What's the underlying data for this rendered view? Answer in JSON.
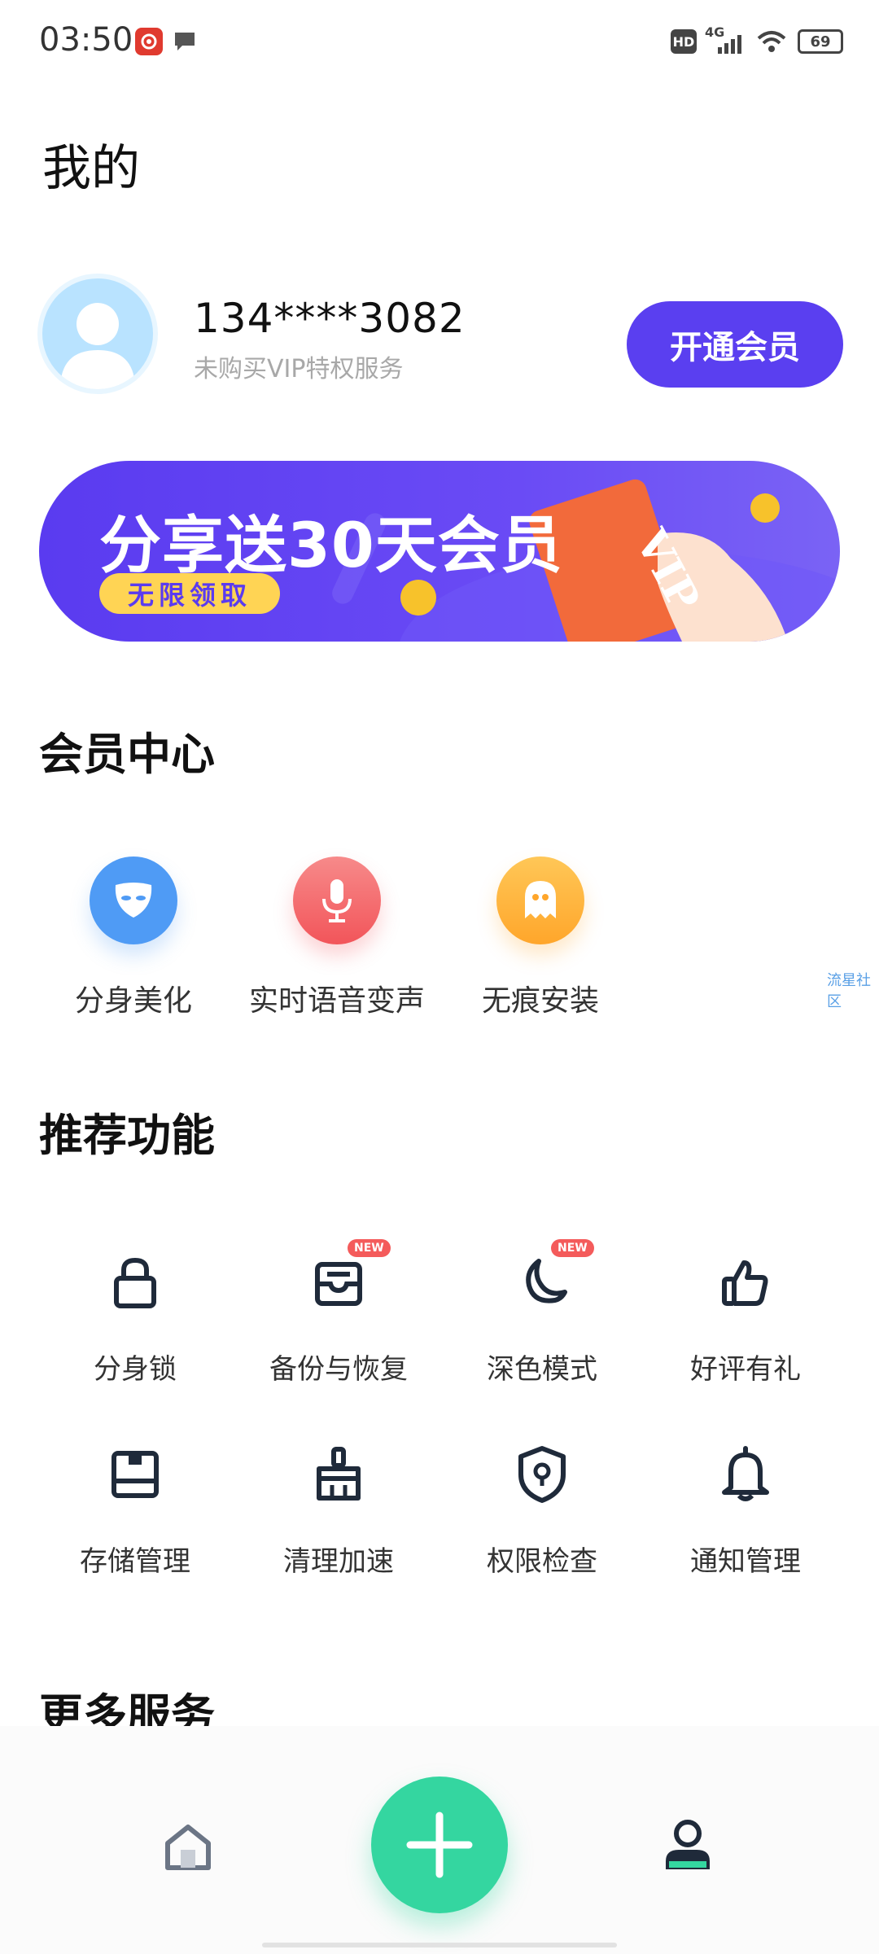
{
  "status_bar": {
    "time": "03:50",
    "network": "4G",
    "battery": "69",
    "hd_label": "HD"
  },
  "header": {
    "title": "我的"
  },
  "profile": {
    "phone": "134****3082",
    "subtitle": "未购买VIP特权服务",
    "vip_button": "开通会员"
  },
  "banner": {
    "title": "分享送30天会员",
    "pill": "无限领取",
    "card_text": "VIP"
  },
  "member_center": {
    "title": "会员中心",
    "items": [
      {
        "label": "分身美化",
        "icon": "mask-icon",
        "color": "#4f9bf5"
      },
      {
        "label": "实时语音变声",
        "icon": "microphone-icon",
        "color": "#f56b6b"
      },
      {
        "label": "无痕安装",
        "icon": "ghost-icon",
        "color": "#ffb33d"
      }
    ]
  },
  "watermark": "流星社区",
  "recommended": {
    "title": "推荐功能",
    "items": [
      {
        "label": "分身锁",
        "icon": "lock-icon"
      },
      {
        "label": "备份与恢复",
        "icon": "inbox-icon",
        "badge": "NEW"
      },
      {
        "label": "深色模式",
        "icon": "moon-icon",
        "badge": "NEW"
      },
      {
        "label": "好评有礼",
        "icon": "thumbs-up-icon"
      },
      {
        "label": "存储管理",
        "icon": "storage-icon"
      },
      {
        "label": "清理加速",
        "icon": "broom-icon"
      },
      {
        "label": "权限检查",
        "icon": "shield-icon"
      },
      {
        "label": "通知管理",
        "icon": "bell-icon"
      }
    ]
  },
  "more_services": {
    "title": "更多服务"
  },
  "bottom_nav": {
    "items": [
      "home-icon",
      "add-icon",
      "profile-icon"
    ]
  },
  "colors": {
    "accent": "#5a3ff0",
    "fab": "#34d6a0",
    "badge": "#f45b5b",
    "banner_pill": "#ffd454"
  }
}
